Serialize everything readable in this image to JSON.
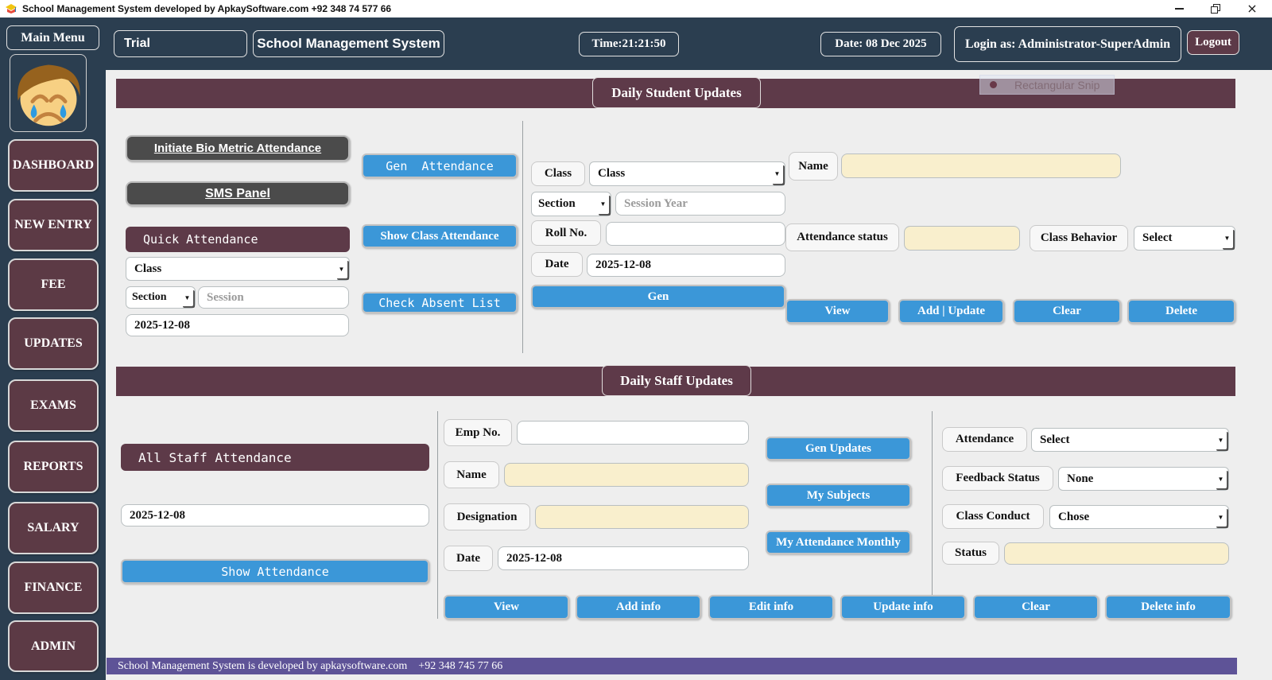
{
  "window": {
    "title": "School Management System developed by ApkaySoftware.com +92 348 74 577 66",
    "close_glyph": "×"
  },
  "icons": {
    "dropdown": "▼"
  },
  "topbar": {
    "main_menu": "Main Menu",
    "trial": "Trial",
    "app_name": "School Management System",
    "time": "Time:21:21:50",
    "date": "Date: 08 Dec 2025",
    "login": "Login as: Administrator-SuperAdmin",
    "logout": "Logout"
  },
  "sidebar": {
    "items": [
      {
        "label": "DASHBOARD"
      },
      {
        "label": "NEW ENTRY"
      },
      {
        "label": "FEE"
      },
      {
        "label": "UPDATES"
      },
      {
        "label": "EXAMS"
      },
      {
        "label": "REPORTS"
      },
      {
        "label": "SALARY"
      },
      {
        "label": "FINANCE"
      },
      {
        "label": "ADMIN"
      }
    ]
  },
  "snip_artifact": {
    "label": "Rectangular Snip"
  },
  "student": {
    "header": "Daily Student Updates",
    "bio_metric_btn": "Initiate Bio Metric Attendance",
    "sms_panel_btn": "SMS Panel",
    "quick_attendance_label": "Quick Attendance",
    "class_combo": "Class",
    "section_combo": "Section",
    "session_placeholder": "Session",
    "date_value": "2025-12-08",
    "gen_attendance_btn": "Gen  Attendance",
    "show_class_attendance_btn": "Show Class Attendance",
    "check_absent_btn": "Check Absent List",
    "form": {
      "class_label": "Class",
      "class_combo": "Class",
      "section_combo": "Section",
      "session_year_placeholder": "Session Year",
      "roll_label": "Roll No.",
      "roll_value": "",
      "date_label": "Date",
      "date_value": "2025-12-08",
      "gen_btn": "Gen"
    },
    "detail": {
      "name_label": "Name",
      "name_value": "",
      "attendance_status_label": "Attendance status",
      "attendance_status_value": "",
      "class_behavior_label": "Class Behavior",
      "class_behavior_value": "Select",
      "view_btn": "View",
      "add_update_btn": "Add | Update",
      "clear_btn": "Clear",
      "delete_btn": "Delete"
    }
  },
  "staff": {
    "header": "Daily Staff Updates",
    "all_staff_label": "All Staff Attendance",
    "date_value": "2025-12-08",
    "show_attendance_btn": "Show Attendance",
    "form": {
      "emp_label": "Emp No.",
      "emp_value": "",
      "name_label": "Name",
      "name_value": "",
      "designation_label": "Designation",
      "designation_value": "",
      "date_label": "Date",
      "date_value": "2025-12-08"
    },
    "actions": {
      "gen_updates_btn": "Gen Updates",
      "my_subjects_btn": "My Subjects",
      "my_attendance_btn": "My Attendance Monthly"
    },
    "detail": {
      "attendance_label": "Attendance",
      "attendance_value": "Select",
      "feedback_label": "Feedback Status",
      "feedback_value": "None",
      "conduct_label": "Class Conduct",
      "conduct_value": "Chose",
      "status_label": "Status",
      "status_value": ""
    },
    "bottom": {
      "view_btn": "View",
      "add_btn": "Add info",
      "edit_btn": "Edit info",
      "update_btn": "Update info",
      "clear_btn": "Clear",
      "delete_btn": "Delete info"
    }
  },
  "footer": {
    "text": "School Management System is developed by apkaysoftware.com    +92 348 745 77 66"
  },
  "colors": {
    "navy": "#2b3e50",
    "maroon": "#5e3a49",
    "blue": "#3b97d8",
    "cream": "#f9efcd",
    "purple": "#5e5397"
  }
}
